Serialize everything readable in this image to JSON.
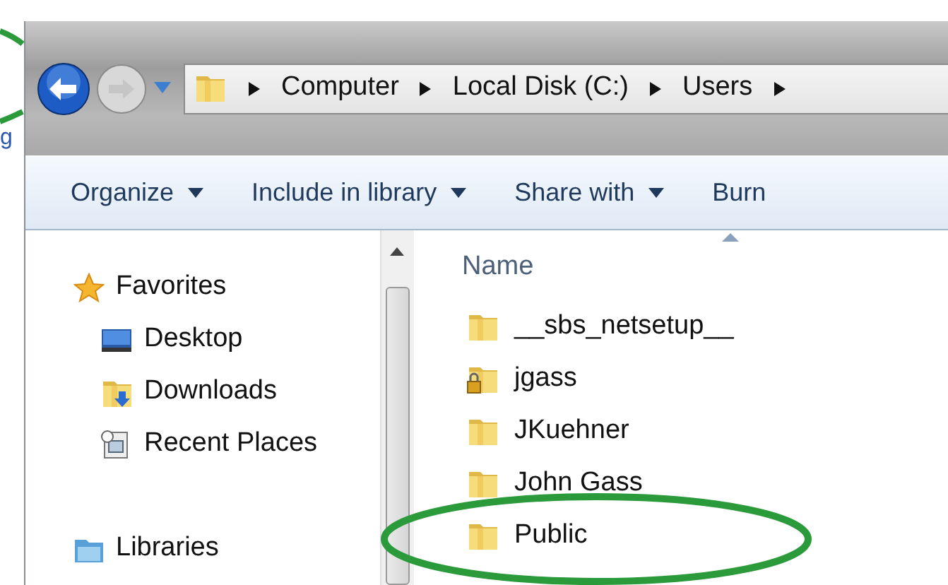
{
  "background_page": {
    "text": "g"
  },
  "nav": {
    "breadcrumbs": [
      "Computer",
      "Local Disk (C:)",
      "Users"
    ]
  },
  "toolbar": [
    {
      "label": "Organize",
      "dropdown": true
    },
    {
      "label": "Include in library",
      "dropdown": true
    },
    {
      "label": "Share with",
      "dropdown": true
    },
    {
      "label": "Burn",
      "dropdown": false
    }
  ],
  "sidebar": {
    "groups": [
      {
        "label": "Favorites",
        "kind": "favorites",
        "items": [
          {
            "label": "Desktop",
            "kind": "desktop"
          },
          {
            "label": "Downloads",
            "kind": "downloads"
          },
          {
            "label": "Recent Places",
            "kind": "recent"
          }
        ]
      },
      {
        "label": "Libraries",
        "kind": "libraries"
      }
    ]
  },
  "list": {
    "column_header": "Name",
    "sorted": true,
    "files": [
      {
        "name": "__sbs_netsetup__",
        "locked": false,
        "circled": false
      },
      {
        "name": "jgass",
        "locked": true,
        "circled": false
      },
      {
        "name": "JKuehner",
        "locked": false,
        "circled": false
      },
      {
        "name": "John Gass",
        "locked": false,
        "circled": false
      },
      {
        "name": "Public",
        "locked": false,
        "circled": true
      }
    ]
  }
}
